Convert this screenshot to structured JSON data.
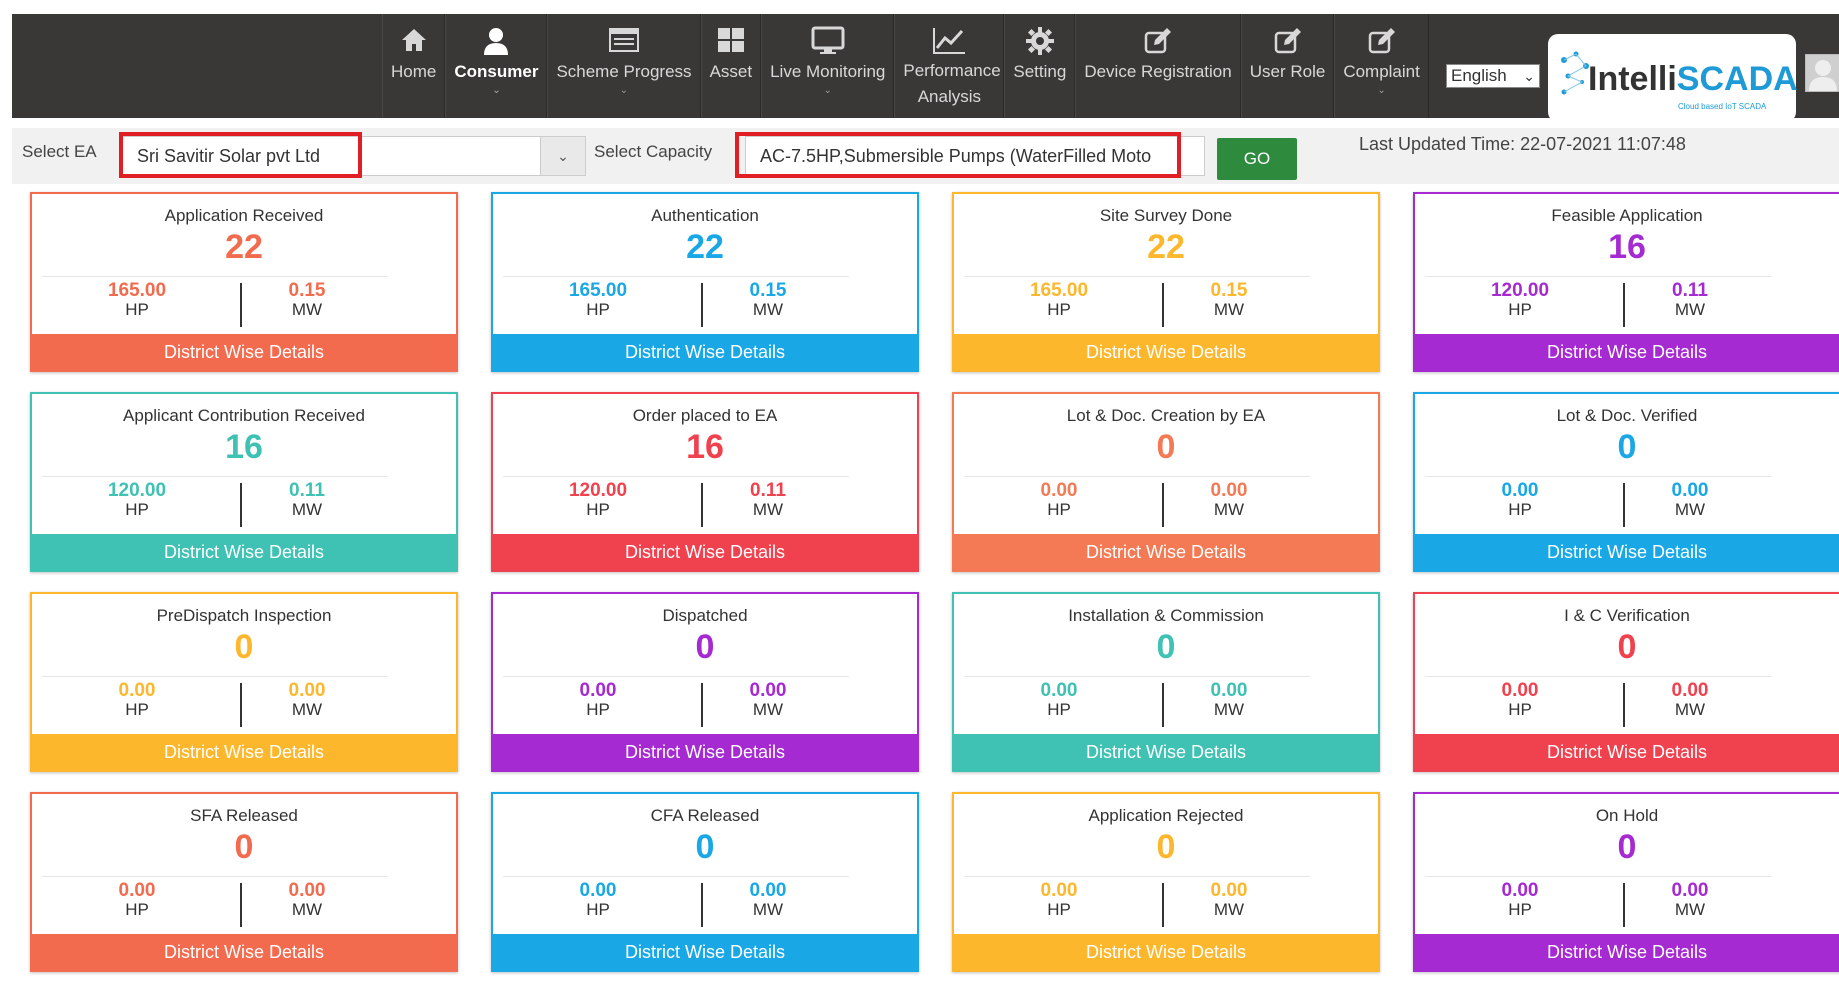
{
  "nav": {
    "items": [
      {
        "label": "Home",
        "icon": "home-icon",
        "active": false,
        "caret": false
      },
      {
        "label": "Consumer",
        "icon": "user-icon",
        "active": true,
        "caret": true
      },
      {
        "label": "Scheme Progress",
        "icon": "list-window-icon",
        "active": false,
        "caret": true
      },
      {
        "label": "Asset",
        "icon": "grid-icon",
        "active": false,
        "caret": false
      },
      {
        "label": "Live Monitoring",
        "icon": "monitor-icon",
        "active": false,
        "caret": true
      },
      {
        "label": "Performance Analysis",
        "icon": "line-chart-icon",
        "active": false,
        "caret": false
      },
      {
        "label": "Setting",
        "icon": "gear-icon",
        "active": false,
        "caret": false
      },
      {
        "label": "Device Registration",
        "icon": "edit-icon",
        "active": false,
        "caret": false
      },
      {
        "label": "User Role",
        "icon": "edit-icon",
        "active": false,
        "caret": false
      },
      {
        "label": "Complaint",
        "icon": "edit-icon",
        "active": false,
        "caret": true
      }
    ],
    "language": "English",
    "logo_part1": "Intelli",
    "logo_part2": "SCADA",
    "logo_tagline": "Cloud based IoT SCADA"
  },
  "filters": {
    "ea_label": "Select EA",
    "ea_value": "Sri Savitir Solar pvt Ltd",
    "capacity_label": "Select Capacity",
    "capacity_value": "AC-7.5HP,Submersible Pumps (WaterFilled Moto",
    "go_label": "GO",
    "last_updated": "Last Updated Time: 22-07-2021 11:07:48"
  },
  "colors": {
    "red_orange": "#f26b4f",
    "blue": "#1aa7e6",
    "yellow": "#fdb72c",
    "purple": "#a52ad1",
    "teal": "#3fc1b4",
    "red": "#f0414f",
    "orange": "#f47a55"
  },
  "cards": [
    {
      "title": "Application Received",
      "count": "22",
      "hp": "165.00",
      "hp_unit": "HP",
      "mw": "0.15",
      "mw_unit": "MW",
      "footer": "District Wise Details",
      "color": "#f26b4f"
    },
    {
      "title": "Authentication",
      "count": "22",
      "hp": "165.00",
      "hp_unit": "HP",
      "mw": "0.15",
      "mw_unit": "MW",
      "footer": "District Wise Details",
      "color": "#1aa7e6"
    },
    {
      "title": "Site Survey Done",
      "count": "22",
      "hp": "165.00",
      "hp_unit": "HP",
      "mw": "0.15",
      "mw_unit": "MW",
      "footer": "District Wise Details",
      "color": "#fdb72c"
    },
    {
      "title": "Feasible Application",
      "count": "16",
      "hp": "120.00",
      "hp_unit": "HP",
      "mw": "0.11",
      "mw_unit": "MW",
      "footer": "District Wise Details",
      "color": "#a52ad1"
    },
    {
      "title": "Applicant Contribution Received",
      "count": "16",
      "hp": "120.00",
      "hp_unit": "HP",
      "mw": "0.11",
      "mw_unit": "MW",
      "footer": "District Wise Details",
      "color": "#3fc1b4"
    },
    {
      "title": "Order placed to EA",
      "count": "16",
      "hp": "120.00",
      "hp_unit": "HP",
      "mw": "0.11",
      "mw_unit": "MW",
      "footer": "District Wise Details",
      "color": "#f0414f"
    },
    {
      "title": "Lot & Doc. Creation by EA",
      "count": "0",
      "hp": "0.00",
      "hp_unit": "HP",
      "mw": "0.00",
      "mw_unit": "MW",
      "footer": "District Wise Details",
      "color": "#f47a55"
    },
    {
      "title": "Lot & Doc. Verified",
      "count": "0",
      "hp": "0.00",
      "hp_unit": "HP",
      "mw": "0.00",
      "mw_unit": "MW",
      "footer": "District Wise Details",
      "color": "#1aa7e6"
    },
    {
      "title": "PreDispatch Inspection",
      "count": "0",
      "hp": "0.00",
      "hp_unit": "HP",
      "mw": "0.00",
      "mw_unit": "MW",
      "footer": "District Wise Details",
      "color": "#fdb72c"
    },
    {
      "title": "Dispatched",
      "count": "0",
      "hp": "0.00",
      "hp_unit": "HP",
      "mw": "0.00",
      "mw_unit": "MW",
      "footer": "District Wise Details",
      "color": "#a52ad1"
    },
    {
      "title": "Installation & Commission",
      "count": "0",
      "hp": "0.00",
      "hp_unit": "HP",
      "mw": "0.00",
      "mw_unit": "MW",
      "footer": "District Wise Details",
      "color": "#3fc1b4"
    },
    {
      "title": "I & C Verification",
      "count": "0",
      "hp": "0.00",
      "hp_unit": "HP",
      "mw": "0.00",
      "mw_unit": "MW",
      "footer": "District Wise Details",
      "color": "#f0414f"
    },
    {
      "title": "SFA Released",
      "count": "0",
      "hp": "0.00",
      "hp_unit": "HP",
      "mw": "0.00",
      "mw_unit": "MW",
      "footer": "District Wise Details",
      "color": "#f26b4f"
    },
    {
      "title": "CFA Released",
      "count": "0",
      "hp": "0.00",
      "hp_unit": "HP",
      "mw": "0.00",
      "mw_unit": "MW",
      "footer": "District Wise Details",
      "color": "#1aa7e6"
    },
    {
      "title": "Application Rejected",
      "count": "0",
      "hp": "0.00",
      "hp_unit": "HP",
      "mw": "0.00",
      "mw_unit": "MW",
      "footer": "District Wise Details",
      "color": "#fdb72c"
    },
    {
      "title": "On Hold",
      "count": "0",
      "hp": "0.00",
      "hp_unit": "HP",
      "mw": "0.00",
      "mw_unit": "MW",
      "footer": "District Wise Details",
      "color": "#a52ad1"
    }
  ]
}
